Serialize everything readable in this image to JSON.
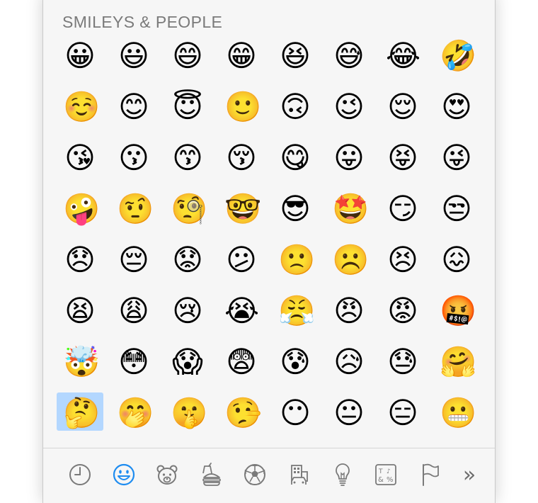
{
  "picker": {
    "section_title": "SMILEYS & PEOPLE",
    "emoji_rows": [
      [
        "😀",
        "😃",
        "😄",
        "😁",
        "😆",
        "😅",
        "😂",
        "🤣"
      ],
      [
        "☺️",
        "😊",
        "😇",
        "🙂",
        "🙃",
        "😉",
        "😌",
        "😍"
      ],
      [
        "😘",
        "😗",
        "😙",
        "😚",
        "😋",
        "😛",
        "😝",
        "😜"
      ],
      [
        "🤪",
        "🤨",
        "🧐",
        "🤓",
        "😎",
        "🤩",
        "😏",
        "😒"
      ],
      [
        "😞",
        "😔",
        "😟",
        "😕",
        "🙁",
        "☹️",
        "😣",
        "😖"
      ],
      [
        "😫",
        "😩",
        "😢",
        "😭",
        "😤",
        "😠",
        "😡",
        "🤬"
      ],
      [
        "🤯",
        "😳",
        "😱",
        "😨",
        "😰",
        "😥",
        "😓",
        "🤗"
      ],
      [
        "🤔",
        "🤭",
        "🤫",
        "🤥",
        "😶",
        "😐",
        "😑",
        "😬"
      ]
    ],
    "selected": {
      "row": 7,
      "col": 0
    },
    "more_label": "»",
    "categories": [
      {
        "name": "recent",
        "icon": "clock-icon",
        "selected": false
      },
      {
        "name": "smileys-people",
        "icon": "smiley-icon",
        "selected": true
      },
      {
        "name": "animals-nature",
        "icon": "bear-icon",
        "selected": false
      },
      {
        "name": "food-drink",
        "icon": "burger-icon",
        "selected": false
      },
      {
        "name": "activity",
        "icon": "soccer-ball-icon",
        "selected": false
      },
      {
        "name": "travel-places",
        "icon": "building-car-icon",
        "selected": false
      },
      {
        "name": "objects",
        "icon": "lightbulb-icon",
        "selected": false
      },
      {
        "name": "symbols",
        "icon": "symbols-icon",
        "selected": false
      },
      {
        "name": "flags",
        "icon": "flag-icon",
        "selected": false
      }
    ]
  },
  "colors": {
    "panel_background": "#f6f6f6",
    "selection": "#b3d7ff",
    "accent": "#1e8cf0",
    "icon_gray": "#7a7a7a",
    "title_gray": "#7a7a7a"
  }
}
